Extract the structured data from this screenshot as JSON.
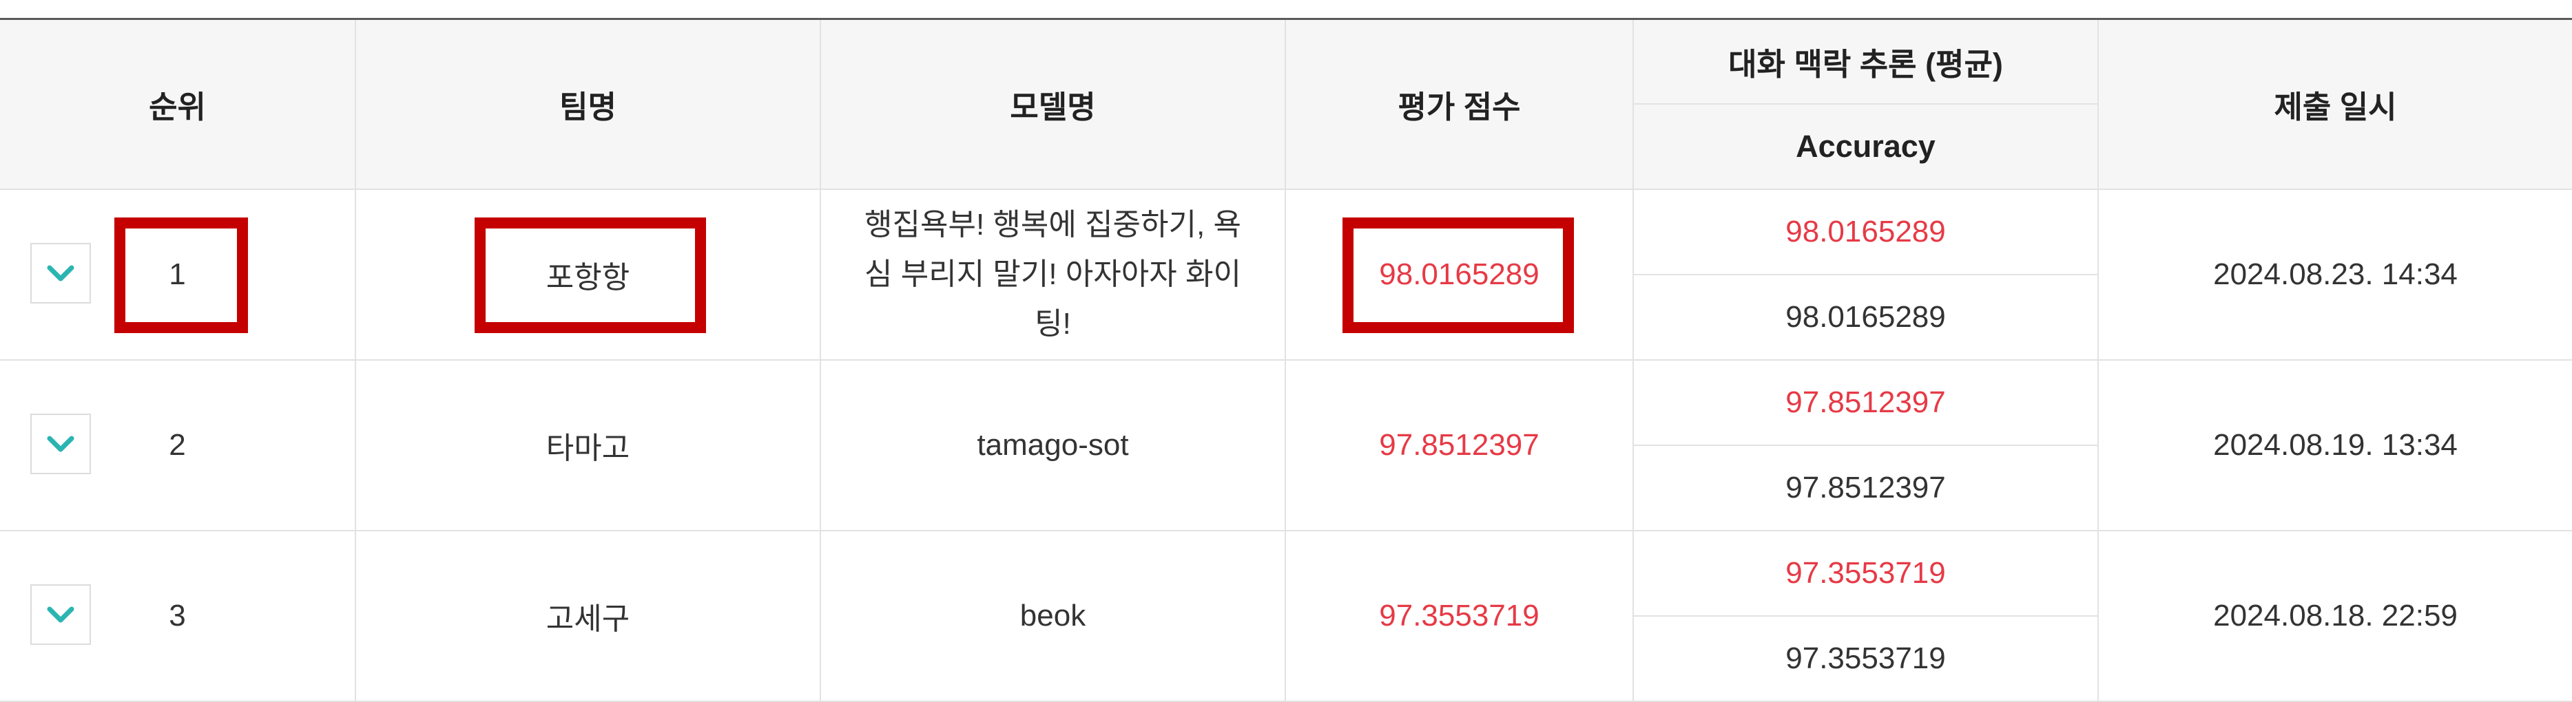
{
  "headers": {
    "rank": "순위",
    "team": "팀명",
    "model": "모델명",
    "score": "평가 점수",
    "metric_group": "대화 맥락 추론 (평균)",
    "metric": "Accuracy",
    "submitted": "제출 일시"
  },
  "rows": [
    {
      "rank": "1",
      "team": "포항항",
      "model": "행집욕부! 행복에 집중하기, 욕심 부리지 말기! 아자아자 화이팅!",
      "score": "98.0165289",
      "accuracy_top": "98.0165289",
      "accuracy_bottom": "98.0165289",
      "submitted": "2024.08.23. 14:34"
    },
    {
      "rank": "2",
      "team": "타마고",
      "model": "tamago-sot",
      "score": "97.8512397",
      "accuracy_top": "97.8512397",
      "accuracy_bottom": "97.8512397",
      "submitted": "2024.08.19. 13:34"
    },
    {
      "rank": "3",
      "team": "고세구",
      "model": "beok",
      "score": "97.3553719",
      "accuracy_top": "97.3553719",
      "accuracy_bottom": "97.3553719",
      "submitted": "2024.08.18. 22:59"
    }
  ],
  "icons": {
    "expand": "chevron-down-icon"
  },
  "colors": {
    "score": "#e63a46",
    "highlight": "#c40000",
    "chevron": "#2bb5b2"
  }
}
